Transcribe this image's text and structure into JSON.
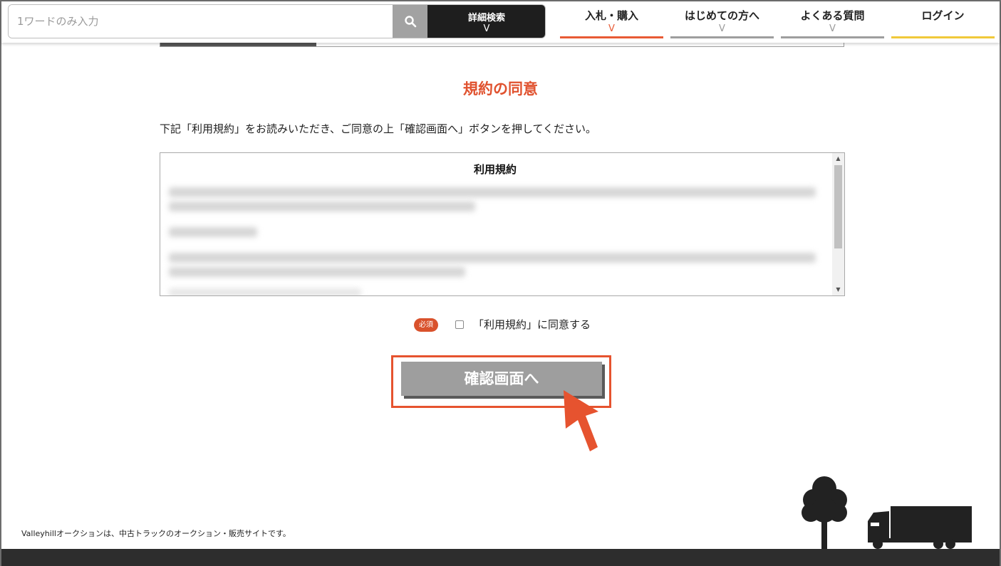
{
  "header": {
    "search": {
      "placeholder": "1ワードのみ入力"
    },
    "advanced_search": {
      "label": "詳細検索",
      "chevron": "V"
    },
    "nav": [
      {
        "label": "入札・購入",
        "chevron": "V"
      },
      {
        "label": "はじめての方へ",
        "chevron": "V"
      },
      {
        "label": "よくある質問",
        "chevron": "V"
      },
      {
        "label": "ログイン"
      }
    ]
  },
  "main": {
    "title": "規約の同意",
    "instruction": "下記「利用規約」をお読みいただき、ご同意の上「確認画面へ」ボタンを押してください。",
    "terms": {
      "title": "利用規約"
    },
    "agree": {
      "badge": "必須",
      "label": "「利用規約」に同意する",
      "checked": false
    },
    "confirm_button": "確認画面へ"
  },
  "footer": {
    "text": "Valleyhillオークションは、中古トラックのオークション・販売サイトです。"
  },
  "colors": {
    "accent": "#e0522f",
    "nav_active": "#e85a35",
    "login_bar": "#f0c93a",
    "footer_bar": "#2d2d2d",
    "button": "#9e9e9e"
  }
}
